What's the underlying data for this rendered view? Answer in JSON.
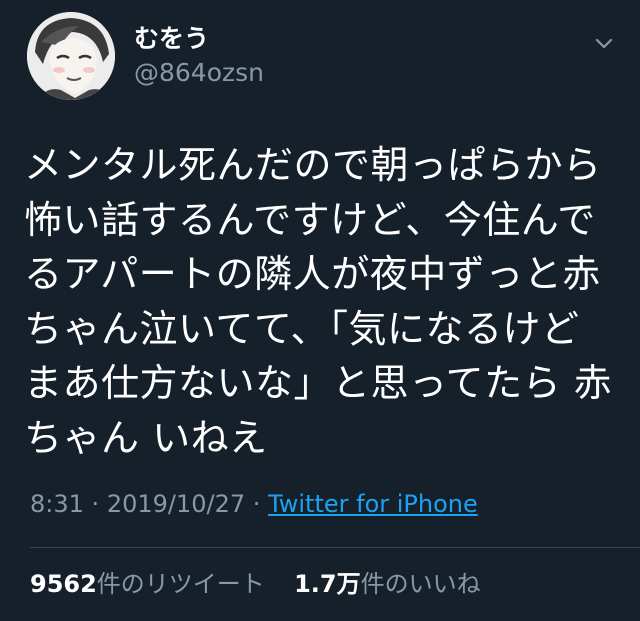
{
  "user": {
    "display_name": "むをう",
    "handle": "@864ozsn"
  },
  "tweet": {
    "lines": [
      "メンタル死んだので朝っぱらから",
      "怖い話するんですけど、今住んで",
      "るアパートの隣人が夜中ずっと赤",
      "ちゃん泣いてて、「気になるけど",
      "まあ仕方ないな」と思ってたら 赤",
      "ちゃん いねえ"
    ],
    "time": "8:31",
    "date": "2019/10/27",
    "separator": "·",
    "source": "Twitter for iPhone"
  },
  "stats": {
    "retweets_count": "9562",
    "retweets_label": "件のリツイート",
    "likes_count": "1.7万",
    "likes_label": "件のいいね"
  },
  "icons": {
    "menu": "chevron-down-icon",
    "avatar": "avatar-image"
  },
  "colors": {
    "background": "#15202b",
    "text_primary": "#ffffff",
    "text_secondary": "#8899a6",
    "link": "#1da1f2",
    "divider": "#38444d"
  }
}
